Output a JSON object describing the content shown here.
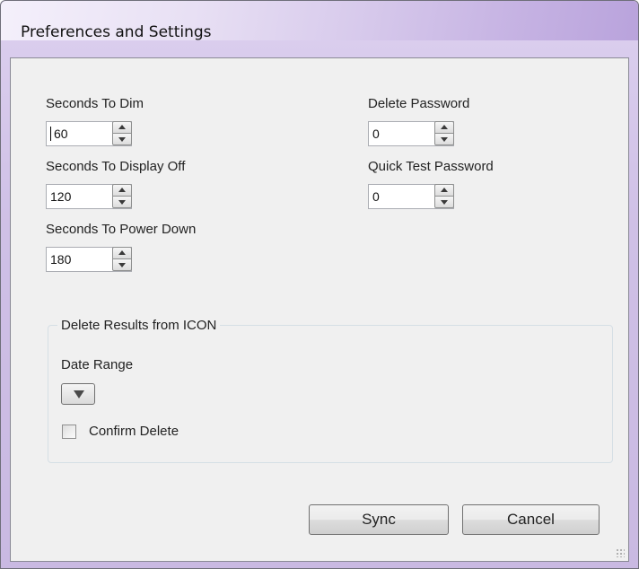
{
  "window": {
    "title": "Preferences and Settings"
  },
  "fields": {
    "seconds_to_dim": {
      "label": "Seconds To Dim",
      "value": "60"
    },
    "seconds_to_display_off": {
      "label": "Seconds To Display Off",
      "value": "120"
    },
    "seconds_to_power_down": {
      "label": "Seconds To Power Down",
      "value": "180"
    },
    "delete_password": {
      "label": "Delete Password",
      "value": "0"
    },
    "quick_test_password": {
      "label": "Quick Test Password",
      "value": "0"
    }
  },
  "delete_group": {
    "title": "Delete Results from ICON",
    "date_range_label": "Date Range",
    "confirm_delete_label": "Confirm Delete",
    "confirm_delete_checked": false
  },
  "buttons": {
    "sync": "Sync",
    "cancel": "Cancel"
  },
  "icons": {
    "spin_up": "triangle-up-icon",
    "spin_down": "triangle-down-icon",
    "dropdown": "triangle-down-icon"
  }
}
